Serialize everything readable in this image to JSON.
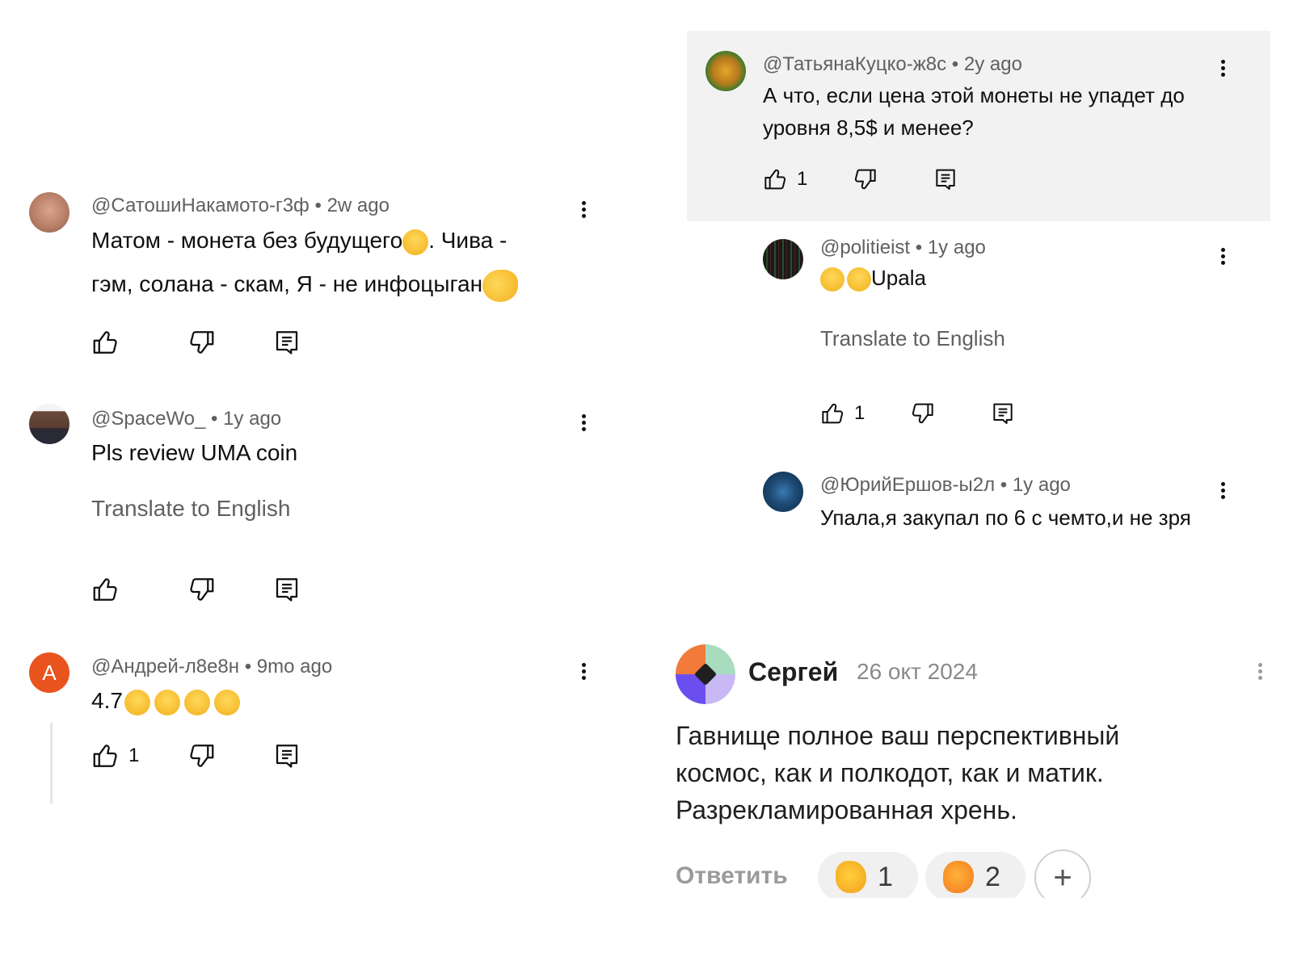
{
  "left_column": {
    "comments": [
      {
        "author": "@СатошиНакамото-г3ф",
        "age": "2w ago",
        "line1": "Матом - монета без будущего",
        "line1_tail": ". Чива -",
        "line2": "гэм, солана - скам, Я - не инфоцыган",
        "likes": ""
      },
      {
        "author": "@SpaceWo_",
        "age": "1y ago",
        "line1": "Pls review UMA coin",
        "translate": "Translate to English",
        "likes": ""
      },
      {
        "author": "@Андрей-л8е8н",
        "age": "9mo ago",
        "avatar_letter": "A",
        "line1": "4.7",
        "likes": "1"
      }
    ]
  },
  "right_column": {
    "highlighted": {
      "author": "@ТатьянаКуцко-ж8с",
      "age": "2y ago",
      "line1": "А что, если цена этой монеты не упадет до",
      "line2": "уровня 8,5$ и менее?",
      "likes": "1"
    },
    "replies": [
      {
        "author": "@politieist",
        "age": "1y ago",
        "line1": "Upala",
        "translate": "Translate to English",
        "likes": "1"
      },
      {
        "author": "@ЮрийЕршов-ы2л",
        "age": "1y ago",
        "line1": "Упала,я закупал по 6 с чемто,и не зря"
      }
    ]
  },
  "ok_comment": {
    "name": "Сергей",
    "date": "26 окт 2024",
    "body_lines": [
      "Гавнище полное ваш перспективный",
      "космос, как и полкодот, как и матик.",
      "Разрекламированная хрень."
    ],
    "reply_label": "Ответить",
    "likes": "1",
    "dislikes": "2",
    "add_symbol": "+"
  },
  "separator": "•",
  "colors": {
    "meta": "#606060",
    "highlight_bg": "#f2f2f2",
    "avatar_orange": "#e8531e",
    "ok_reply": "#9a9a9a"
  },
  "icons": [
    "like-icon",
    "dislike-icon",
    "reply-icon",
    "more-vert-icon",
    "plus-icon"
  ]
}
